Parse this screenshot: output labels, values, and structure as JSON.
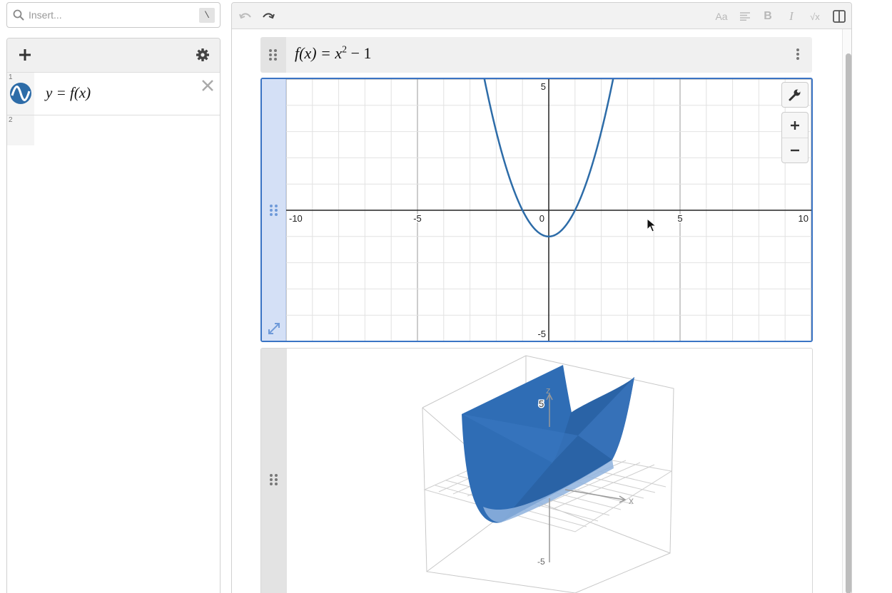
{
  "search": {
    "placeholder": "Insert...",
    "shortcut": "\\"
  },
  "expressions": [
    {
      "number": "1",
      "text": "y = f(x)"
    },
    {
      "number": "2",
      "text": ""
    }
  ],
  "function_block": {
    "lhs": "f(x) = x",
    "exponent": "2",
    "rhs": " − 1"
  },
  "toolbar": {
    "font_label": "Aa",
    "bold_label": "B",
    "italic_label": "I",
    "math_label": "√x"
  },
  "graph2d": {
    "x_ticks": [
      "-10",
      "-5",
      "0",
      "5",
      "10"
    ],
    "y_ticks": [
      "5",
      "-5"
    ],
    "curve_color": "#2d6ca8"
  },
  "graph3d": {
    "axis_labels": {
      "x": "x",
      "z": "z"
    },
    "tick_top": "5",
    "tick_bottom": "-5",
    "surface_color": "#2f6db5"
  },
  "colors": {
    "accent": "#3a74c4",
    "curve": "#2d6ca8"
  }
}
